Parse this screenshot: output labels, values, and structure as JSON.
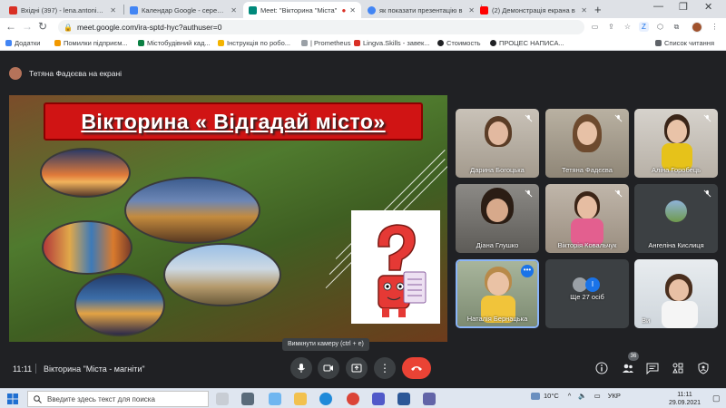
{
  "browser": {
    "tabs": [
      {
        "title": "Вхідні (397) - lena.antoniuk@",
        "fav_color": "#d93025",
        "active": false
      },
      {
        "title": "Календар Google - середа, 2",
        "fav_color": "#4285f4",
        "active": false
      },
      {
        "title": "Meet: \"Вікторина \"Міста\"",
        "fav_color": "#00897b",
        "active": true
      },
      {
        "title": "як показати презентацію в",
        "fav_color": "#4285f4",
        "active": false
      },
      {
        "title": "(2) Демонстрація екрана в",
        "fav_color": "#ff0000",
        "active": false
      }
    ],
    "address": "meet.google.com/ira-sptd-hyc?authuser=0",
    "bookmarks": [
      {
        "label": "Додатки",
        "color": "#4285f4"
      },
      {
        "label": "Помилки підприєм...",
        "color": "#f29900"
      },
      {
        "label": "Містобудівний кад...",
        "color": "#0b8043"
      },
      {
        "label": "Інструкція по робо...",
        "color": "#f4b400"
      },
      {
        "label": "| Prometheus",
        "color": "#ffffff"
      },
      {
        "label": "Lingva.Skills - завек...",
        "color": "#d93025"
      },
      {
        "label": "Стоимость",
        "color": "#202124"
      },
      {
        "label": "ПРОЦЕС НАПИСА...",
        "color": "#202124"
      }
    ],
    "reading_list": "Список читання"
  },
  "meet": {
    "presenter_label": "Тетяна Фадєєва на екрані",
    "slide_title": "Вікторина « Відгадай  місто»",
    "participants": [
      {
        "name": "Дарина Богоцька",
        "muted": true
      },
      {
        "name": "Тетяна Фадєєва",
        "muted": true
      },
      {
        "name": "Аліна Горобець",
        "muted": true
      },
      {
        "name": "Діана Глушко",
        "muted": true
      },
      {
        "name": "Вікторія Ковальчук",
        "muted": true
      },
      {
        "name": "Ангеліна Кислиця",
        "muted": true
      },
      {
        "name": "Наталія Бернацька",
        "muted": false,
        "speaking": true
      },
      {
        "name": "Ще 27 осіб",
        "muted": false
      },
      {
        "name": "Ви",
        "muted": false
      }
    ],
    "time": "11:11",
    "meeting_title": "Вікторина \"Міста - магніти\"",
    "tooltip": "Вимкнути камеру (ctrl + e)",
    "people_count": "36"
  },
  "taskbar": {
    "search_placeholder": "Введите здесь текст для поиска",
    "weather": "10°C",
    "language": "УКР",
    "clock_time": "11:11",
    "clock_date": "29.09.2021"
  }
}
